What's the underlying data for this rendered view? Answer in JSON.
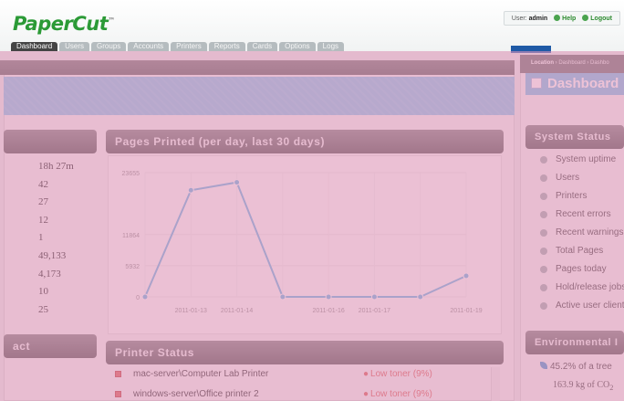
{
  "header": {
    "logo": "PaperCut",
    "logo_tm": "™",
    "user_label": "User:",
    "user_name": "admin",
    "help_label": "Help",
    "logout_label": "Logout"
  },
  "tabs": [
    {
      "label": "Dashboard",
      "active": true
    },
    {
      "label": "Users",
      "active": false
    },
    {
      "label": "Groups",
      "active": false
    },
    {
      "label": "Accounts",
      "active": false
    },
    {
      "label": "Printers",
      "active": false
    },
    {
      "label": "Reports",
      "active": false
    },
    {
      "label": "Cards",
      "active": false
    },
    {
      "label": "Options",
      "active": false
    },
    {
      "label": "Logs",
      "active": false
    }
  ],
  "blue_button": "",
  "panels": {
    "left_top": "",
    "left_bottom": "act",
    "pages_printed": "Pages Printed (per day, last 30 days)",
    "printer_status": "Printer Status",
    "system_status": "System Status",
    "environmental": "Environmental I"
  },
  "stats_values": [
    "18h 27m",
    "42",
    "27",
    "12",
    "1",
    "49,133",
    "4,173",
    "10",
    "25"
  ],
  "chart_data": {
    "type": "line",
    "x": [
      "2011-01-12",
      "2011-01-13",
      "2011-01-14",
      "2011-01-15",
      "2011-01-16",
      "2011-01-17",
      "2011-01-18",
      "2011-01-19"
    ],
    "x_tick_labels": [
      "2011-01-13",
      "2011-01-14",
      "2011-01-16",
      "2011-01-17",
      "2011-01-19"
    ],
    "values": [
      0,
      20300,
      21800,
      0,
      0,
      0,
      0,
      4000
    ],
    "yticks": [
      0,
      5932,
      11864,
      23655
    ],
    "ylim": [
      0,
      23655
    ],
    "grid": true,
    "line_color": "#61b2e3"
  },
  "printer_rows": [
    {
      "name": "mac-server\\Computer Lab Printer",
      "status": "Low toner (9%)"
    },
    {
      "name": "windows-server\\Office printer 2",
      "status": "Low toner (9%)"
    }
  ],
  "breadcrumb": {
    "location_label": "Location",
    "path": " › Dashboard › Dashbo"
  },
  "page_title": "Dashboard",
  "system_status_items": [
    {
      "label": "System uptime",
      "icon": "clock-icon"
    },
    {
      "label": "Users",
      "icon": "users-icon"
    },
    {
      "label": "Printers",
      "icon": "printer-icon"
    },
    {
      "label": "Recent errors",
      "icon": "error-icon"
    },
    {
      "label": "Recent warnings",
      "icon": "warning-icon"
    },
    {
      "label": "Total Pages",
      "icon": "pages-icon"
    },
    {
      "label": "Pages today",
      "icon": "pages-today-icon"
    },
    {
      "label": "Hold/release jobs",
      "icon": "hold-release-icon"
    },
    {
      "label": "Active user clients",
      "icon": "client-icon"
    }
  ],
  "environment": {
    "trees_text": "45.2% of a tree",
    "co2_text": "163.9 kg of CO",
    "co2_sub": "2"
  },
  "colors": {
    "overlay": "#e096b9",
    "accent_blue": "#7fc3ea",
    "logo_green": "#2b9a36",
    "error_red": "#d9534f"
  }
}
